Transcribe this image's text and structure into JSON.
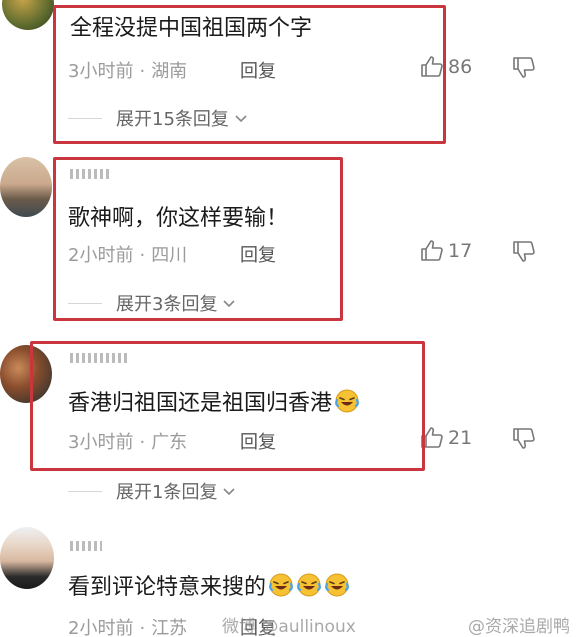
{
  "comments": [
    {
      "text": "全程没提中国祖国两个字",
      "time": "3小时前",
      "location": "湖南",
      "reply_label": "回复",
      "likes": "86",
      "expand_label": "展开15条回复"
    },
    {
      "text": "歌神啊，你这样要输！",
      "time": "2小时前",
      "location": "四川",
      "reply_label": "回复",
      "likes": "17",
      "expand_label": "展开3条回复"
    },
    {
      "text": "香港归祖国还是祖国归香港",
      "time": "3小时前",
      "location": "广东",
      "reply_label": "回复",
      "likes": "21",
      "expand_label": "展开1条回复"
    },
    {
      "text": "看到评论特意来搜的",
      "time": "2小时前",
      "location": "江苏",
      "reply_label": "回复"
    }
  ],
  "watermarks": {
    "weibo": "微博 @aullinoux",
    "account": "@资深追剧鸭"
  },
  "colors": {
    "highlight_box": "#c9363e",
    "meta_text": "#9b9b9b"
  },
  "icons": [
    "thumbs-up-icon",
    "thumbs-down-icon",
    "chevron-down-icon",
    "laughing-crying-emoji"
  ]
}
